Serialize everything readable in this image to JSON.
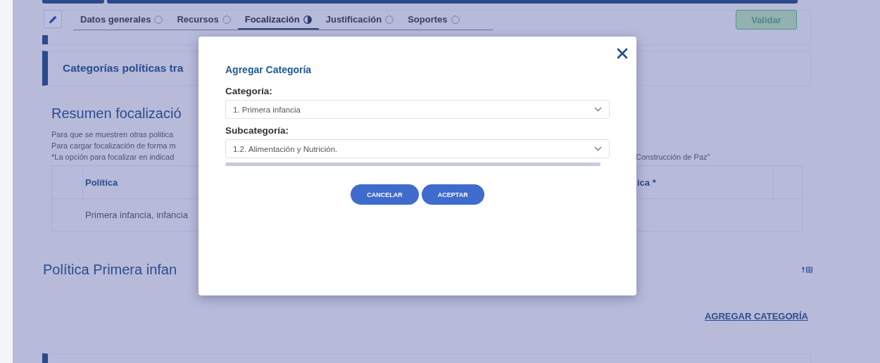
{
  "tabs": [
    {
      "label": "Datos generales",
      "kind": "empty",
      "selected": false
    },
    {
      "label": "Recursos",
      "kind": "empty",
      "selected": false
    },
    {
      "label": "Focalización",
      "kind": "half",
      "selected": true
    },
    {
      "label": "Justificación",
      "kind": "empty",
      "selected": false
    },
    {
      "label": "Soportes",
      "kind": "empty",
      "selected": false
    }
  ],
  "validate_button": "Validar",
  "section_title": "Categorías políticas tra",
  "summary": {
    "title": "Resumen focalizació",
    "notes": [
      "Para que se muestren otras politica",
      "Para cargar focalización de forma m",
      "*La opción para focalizar en indicad"
    ],
    "note_end": "Construcción de Paz\"",
    "table": {
      "columns": [
        "Política",
        "ica *"
      ],
      "rows": [
        [
          "Primera infancia, infancia"
        ]
      ]
    }
  },
  "policy": {
    "title": "Política Primera infan",
    "add_link": "AGREGAR CATEGORÍA"
  },
  "dialog": {
    "title": "Agregar Categoría",
    "fields": [
      {
        "label": "Categoría:",
        "value": "1. Primera infancia"
      },
      {
        "label": "Subcategoría:",
        "value": "1.2. Alimentación y Nutrición."
      }
    ],
    "buttons": [
      "CANCELAR",
      "ACEPTAR"
    ]
  }
}
